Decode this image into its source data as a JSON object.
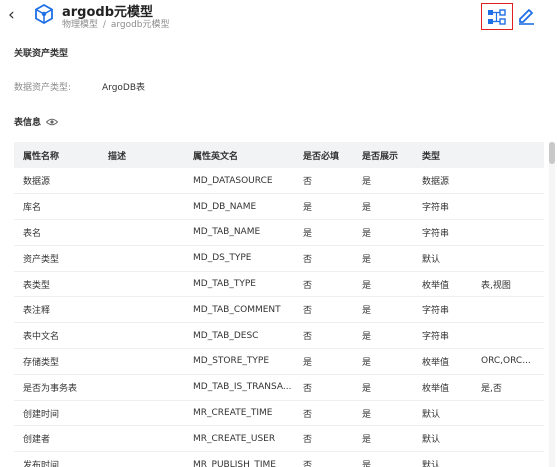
{
  "header": {
    "title": "argodb元模型",
    "breadcrumb": [
      "物理模型",
      "argodb元模型"
    ],
    "breadcrumb_sep": "/",
    "icons": {
      "back": "chevron-left-icon",
      "logo": "cube-icon",
      "lineage": "lineage-graph-icon",
      "edit": "edit-pencil-icon"
    },
    "accent_color": "#1f6fe5",
    "highlight_color": "#e02020"
  },
  "assoc": {
    "title": "关联资产类型",
    "label": "数据资产类型:",
    "value": "ArgoDB表"
  },
  "table_info": {
    "title": "表信息",
    "icon": "eye-icon"
  },
  "table": {
    "headers": [
      "属性名称",
      "描述",
      "属性英文名",
      "是否必填",
      "是否展示",
      "类型",
      ""
    ],
    "rows": [
      [
        "数据源",
        "",
        "MD_DATASOURCE",
        "否",
        "是",
        "数据源",
        ""
      ],
      [
        "库名",
        "",
        "MD_DB_NAME",
        "是",
        "是",
        "字符串",
        ""
      ],
      [
        "表名",
        "",
        "MD_TAB_NAME",
        "是",
        "是",
        "字符串",
        ""
      ],
      [
        "资产类型",
        "",
        "MD_DS_TYPE",
        "否",
        "是",
        "默认",
        ""
      ],
      [
        "表类型",
        "",
        "MD_TAB_TYPE",
        "否",
        "是",
        "枚举值",
        "表,视图"
      ],
      [
        "表注释",
        "",
        "MD_TAB_COMMENT",
        "否",
        "是",
        "字符串",
        ""
      ],
      [
        "表中文名",
        "",
        "MD_TAB_DESC",
        "否",
        "是",
        "字符串",
        ""
      ],
      [
        "存储类型",
        "",
        "MD_STORE_TYPE",
        "是",
        "是",
        "枚举值",
        "ORC,ORC..."
      ],
      [
        "是否为事务表",
        "",
        "MD_TAB_IS_TRANSA...",
        "否",
        "是",
        "枚举值",
        "是,否"
      ],
      [
        "创建时间",
        "",
        "MR_CREATE_TIME",
        "否",
        "是",
        "默认",
        ""
      ],
      [
        "创建者",
        "",
        "MR_CREATE_USER",
        "否",
        "是",
        "默认",
        ""
      ],
      [
        "发布时间",
        "",
        "MR_PUBLISH_TIME",
        "否",
        "是",
        "默认",
        ""
      ]
    ]
  }
}
